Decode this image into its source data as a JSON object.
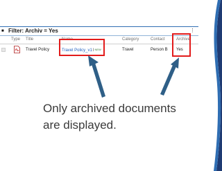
{
  "filter_bar": {
    "title": "Filter: Archiv = Yes",
    "menu_glyph": "⋮"
  },
  "columns": {
    "type": "Type",
    "title": "Title",
    "name": "Name",
    "category": "Category",
    "contact": "Contact",
    "archive": "Archive"
  },
  "rows": [
    {
      "type_icon": "pdf-icon",
      "title": "Travel Policy",
      "name": "Travel Policy_v1",
      "name_badge": "NEW",
      "category": "Travel",
      "contact": "Person B",
      "archive": "Yes"
    }
  ],
  "caption": {
    "line1": "Only archived documents",
    "line2": "are displayed."
  },
  "colors": {
    "highlight": "#e21b1b",
    "arrow": "#2f5f87",
    "accent_dark": "#1f3b73",
    "accent_mid": "#2f6eb3",
    "link": "#1f5fbf"
  }
}
